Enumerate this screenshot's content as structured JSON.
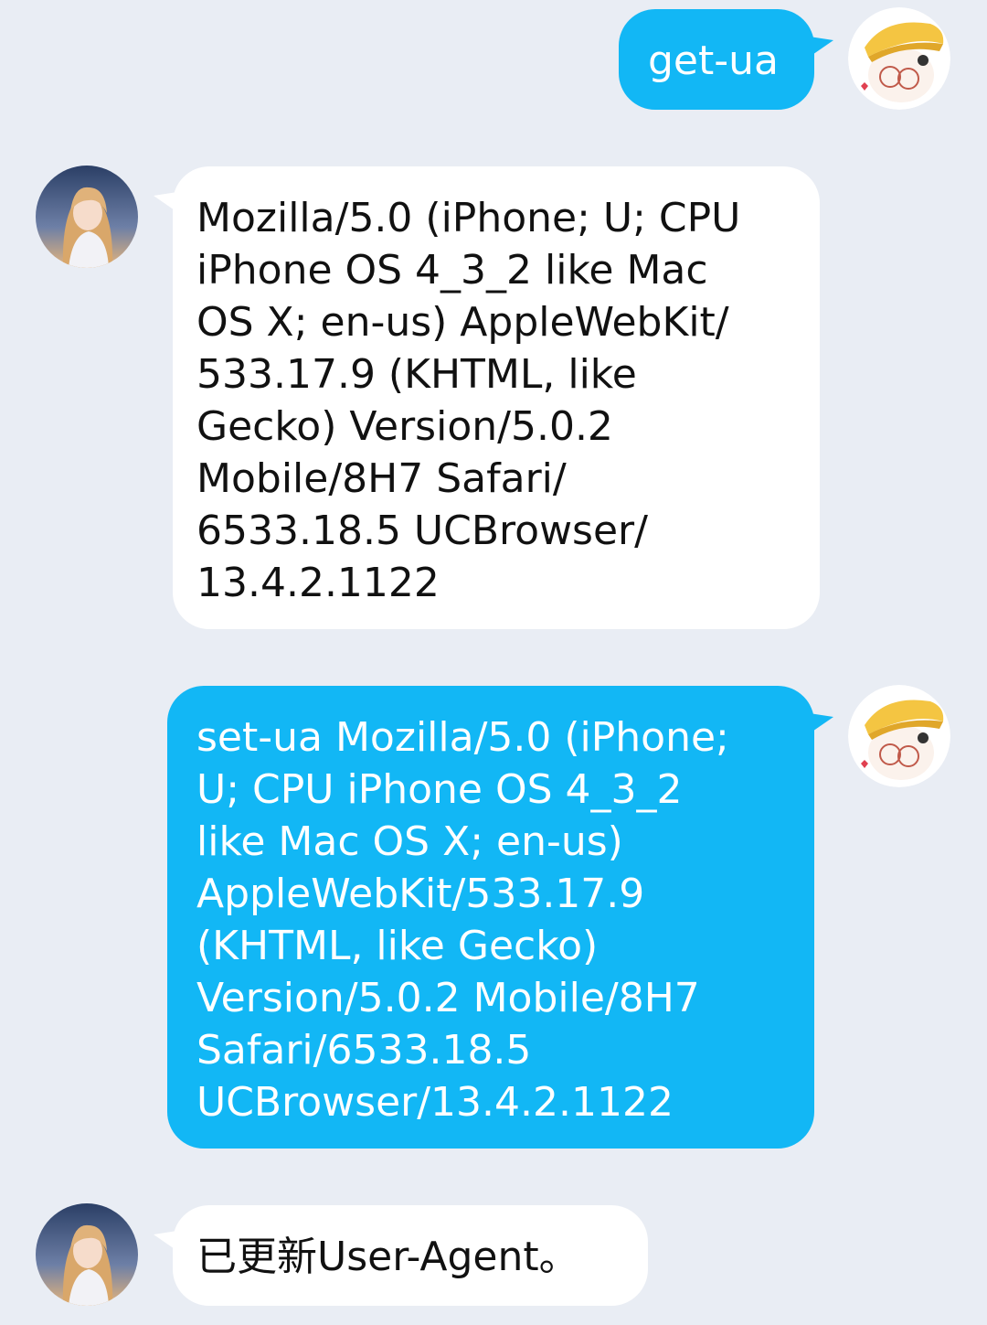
{
  "colors": {
    "background": "#e9edf4",
    "sent_bubble": "#12b7f5",
    "received_bubble": "#ffffff",
    "sent_text": "#ffffff",
    "received_text": "#111111"
  },
  "messages": [
    {
      "direction": "sent",
      "text": "get-ua",
      "avatar": "user-avatar-icon"
    },
    {
      "direction": "received",
      "text": "Mozilla/5.0 (iPhone; U; CPU\niPhone OS 4_3_2 like Mac\nOS X; en-us) AppleWebKit/\n533.17.9 (KHTML, like\nGecko) Version/5.0.2\nMobile/8H7 Safari/\n6533.18.5 UCBrowser/\n13.4.2.1122",
      "avatar": "bot-avatar-icon"
    },
    {
      "direction": "sent",
      "text": "set-ua Mozilla/5.0 (iPhone;\nU; CPU iPhone OS 4_3_2\nlike Mac OS X; en-us)\nAppleWebKit/533.17.9\n(KHTML, like Gecko)\nVersion/5.0.2 Mobile/8H7\nSafari/6533.18.5\nUCBrowser/13.4.2.1122",
      "avatar": "user-avatar-icon"
    },
    {
      "direction": "received",
      "text": "已更新User-Agent。",
      "avatar": "bot-avatar-icon"
    }
  ]
}
